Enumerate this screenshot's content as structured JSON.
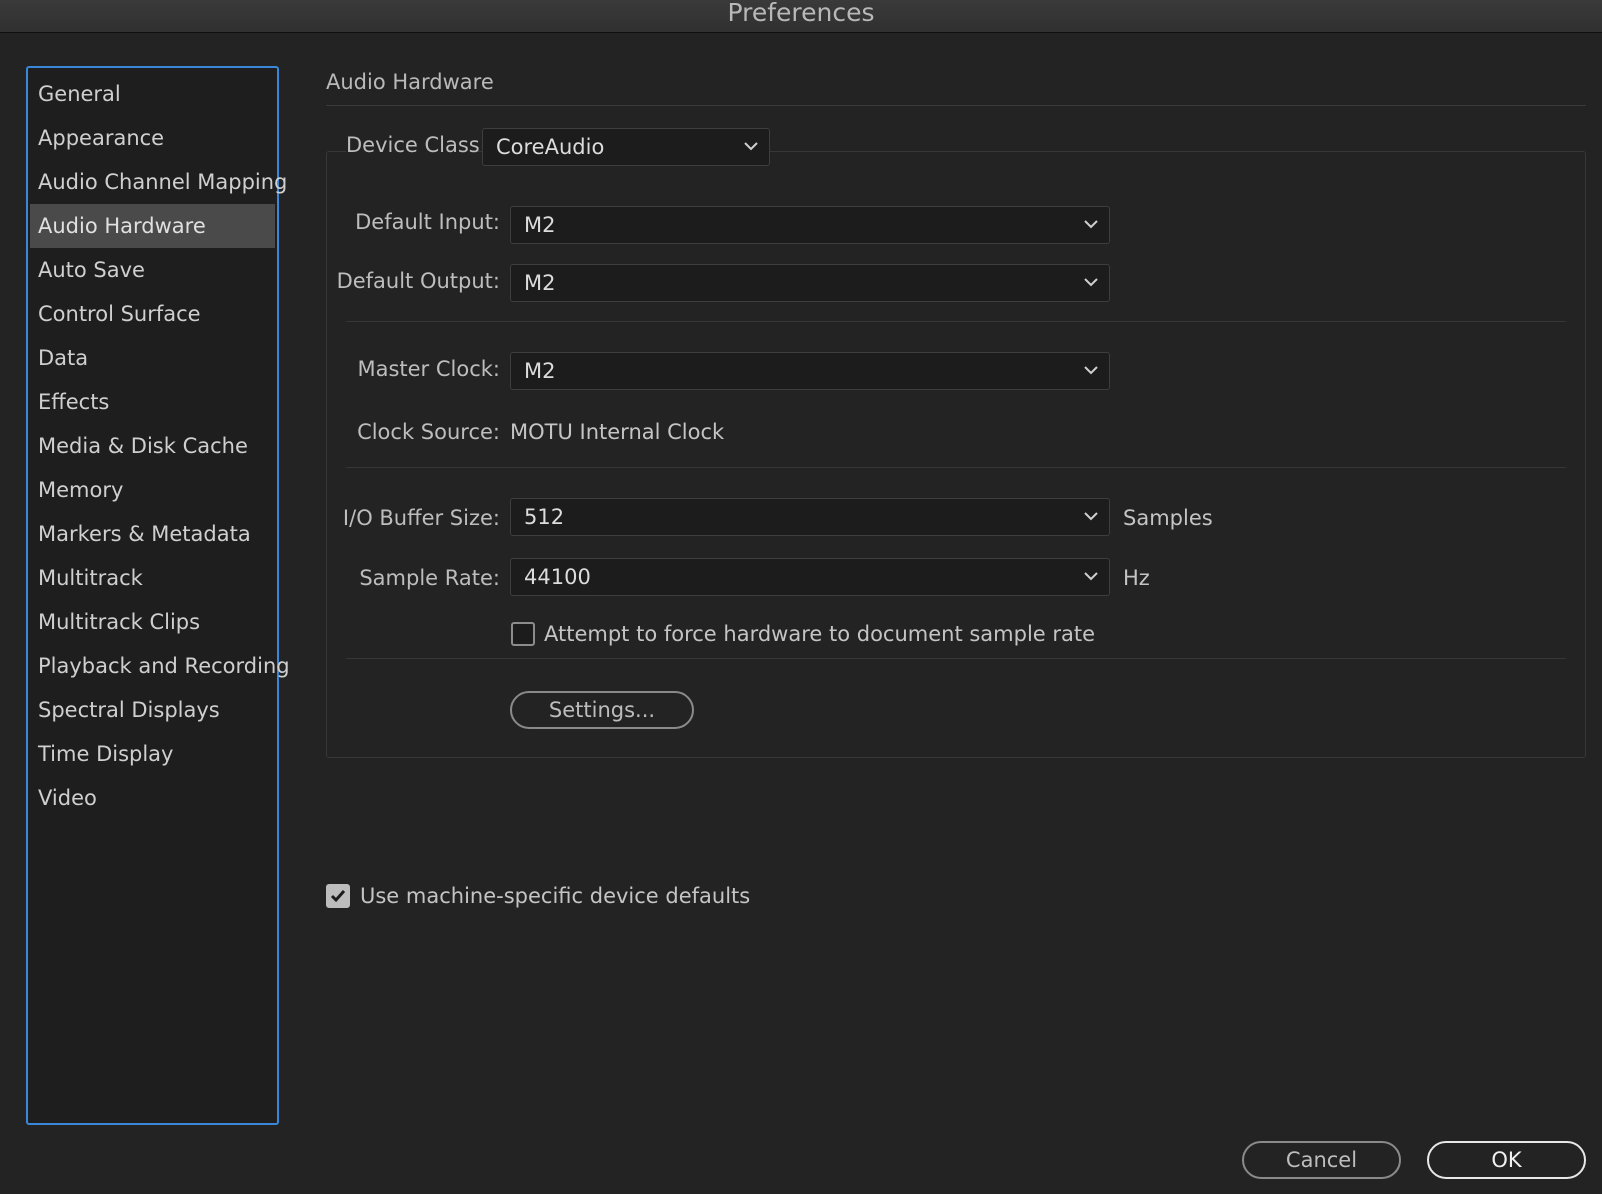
{
  "window": {
    "title": "Preferences"
  },
  "sidebar": {
    "selected_index": 3,
    "items": [
      {
        "label": "General"
      },
      {
        "label": "Appearance"
      },
      {
        "label": "Audio Channel Mapping"
      },
      {
        "label": "Audio Hardware"
      },
      {
        "label": "Auto Save"
      },
      {
        "label": "Control Surface"
      },
      {
        "label": "Data"
      },
      {
        "label": "Effects"
      },
      {
        "label": "Media & Disk Cache"
      },
      {
        "label": "Memory"
      },
      {
        "label": "Markers & Metadata"
      },
      {
        "label": "Multitrack"
      },
      {
        "label": "Multitrack Clips"
      },
      {
        "label": "Playback and Recording"
      },
      {
        "label": "Spectral Displays"
      },
      {
        "label": "Time Display"
      },
      {
        "label": "Video"
      }
    ]
  },
  "main": {
    "section_title": "Audio Hardware",
    "device_class": {
      "label": "Device Class:",
      "value": "CoreAudio"
    },
    "default_input": {
      "label": "Default Input:",
      "value": "M2"
    },
    "default_output": {
      "label": "Default Output:",
      "value": "M2"
    },
    "master_clock": {
      "label": "Master Clock:",
      "value": "M2"
    },
    "clock_source": {
      "label": "Clock Source:",
      "value": "MOTU Internal Clock"
    },
    "io_buffer": {
      "label": "I/O Buffer Size:",
      "value": "512",
      "unit": "Samples"
    },
    "sample_rate": {
      "label": "Sample Rate:",
      "value": "44100",
      "unit": "Hz"
    },
    "force_rate": {
      "label": "Attempt to force hardware to document sample rate",
      "checked": false
    },
    "settings_button": "Settings...",
    "machine_defaults": {
      "label": "Use machine-specific device defaults",
      "checked": true
    }
  },
  "footer": {
    "cancel": "Cancel",
    "ok": "OK"
  },
  "colors": {
    "background": "#232323",
    "sidebar_border": "#3a86d9",
    "selected_item": "#4a4a4a"
  }
}
